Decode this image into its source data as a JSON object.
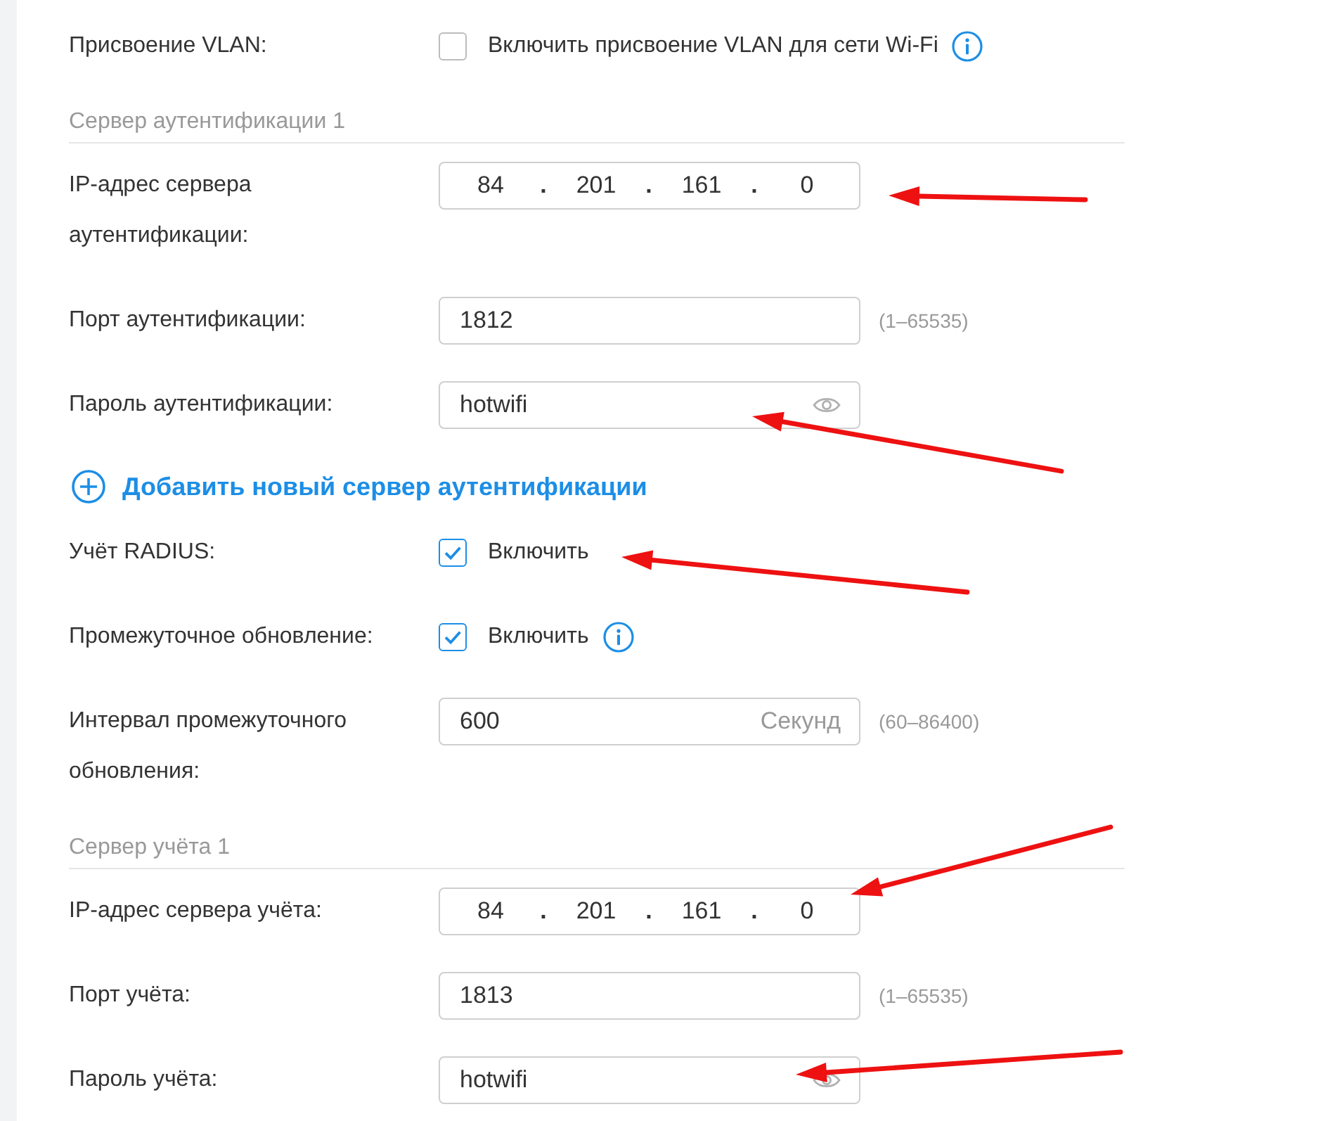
{
  "rows": [
    {
      "kind": "checkbox",
      "label": "Присвоение VLAN:",
      "option": "Включить присвоение VLAN для сети Wi-Fi",
      "checked": false,
      "info": true
    },
    {
      "kind": "section",
      "title": "Сервер аутентификации 1"
    },
    {
      "kind": "ip",
      "label": "IP-адрес сервера аутентификации:",
      "octets": [
        "84",
        "201",
        "161",
        "0"
      ],
      "separators": [
        ".",
        ".",
        "."
      ]
    },
    {
      "kind": "text",
      "label": "Порт аутентификации:",
      "value": "1812",
      "hint": "(1–65535)"
    },
    {
      "kind": "password",
      "label": "Пароль аутентификации:",
      "value": "hotwifi"
    },
    {
      "kind": "link",
      "text": "Добавить новый сервер аутентификации"
    },
    {
      "kind": "checkbox",
      "label": "Учёт RADIUS:",
      "option": "Включить",
      "checked": true,
      "info": false
    },
    {
      "kind": "checkbox",
      "label": "Промежуточное обновление:",
      "option": "Включить",
      "checked": true,
      "info": true
    },
    {
      "kind": "unit",
      "label": "Интервал промежуточного обновления:",
      "value": "600",
      "unit": "Секунд",
      "hint": "(60–86400)"
    },
    {
      "kind": "section",
      "title": "Сервер учёта 1"
    },
    {
      "kind": "ip",
      "label": "IP-адрес сервера учёта:",
      "octets": [
        "84",
        "201",
        "161",
        "0"
      ],
      "separators": [
        ".",
        ".",
        "."
      ]
    },
    {
      "kind": "text",
      "label": "Порт учёта:",
      "value": "1813",
      "hint": "(1–65535)"
    },
    {
      "kind": "password",
      "label": "Пароль учёта:",
      "value": "hotwifi"
    }
  ],
  "annotations": [
    {
      "kind": "arrow"
    },
    {
      "kind": "arrow"
    },
    {
      "kind": "arrow"
    },
    {
      "kind": "arrow"
    },
    {
      "kind": "arrow"
    }
  ]
}
